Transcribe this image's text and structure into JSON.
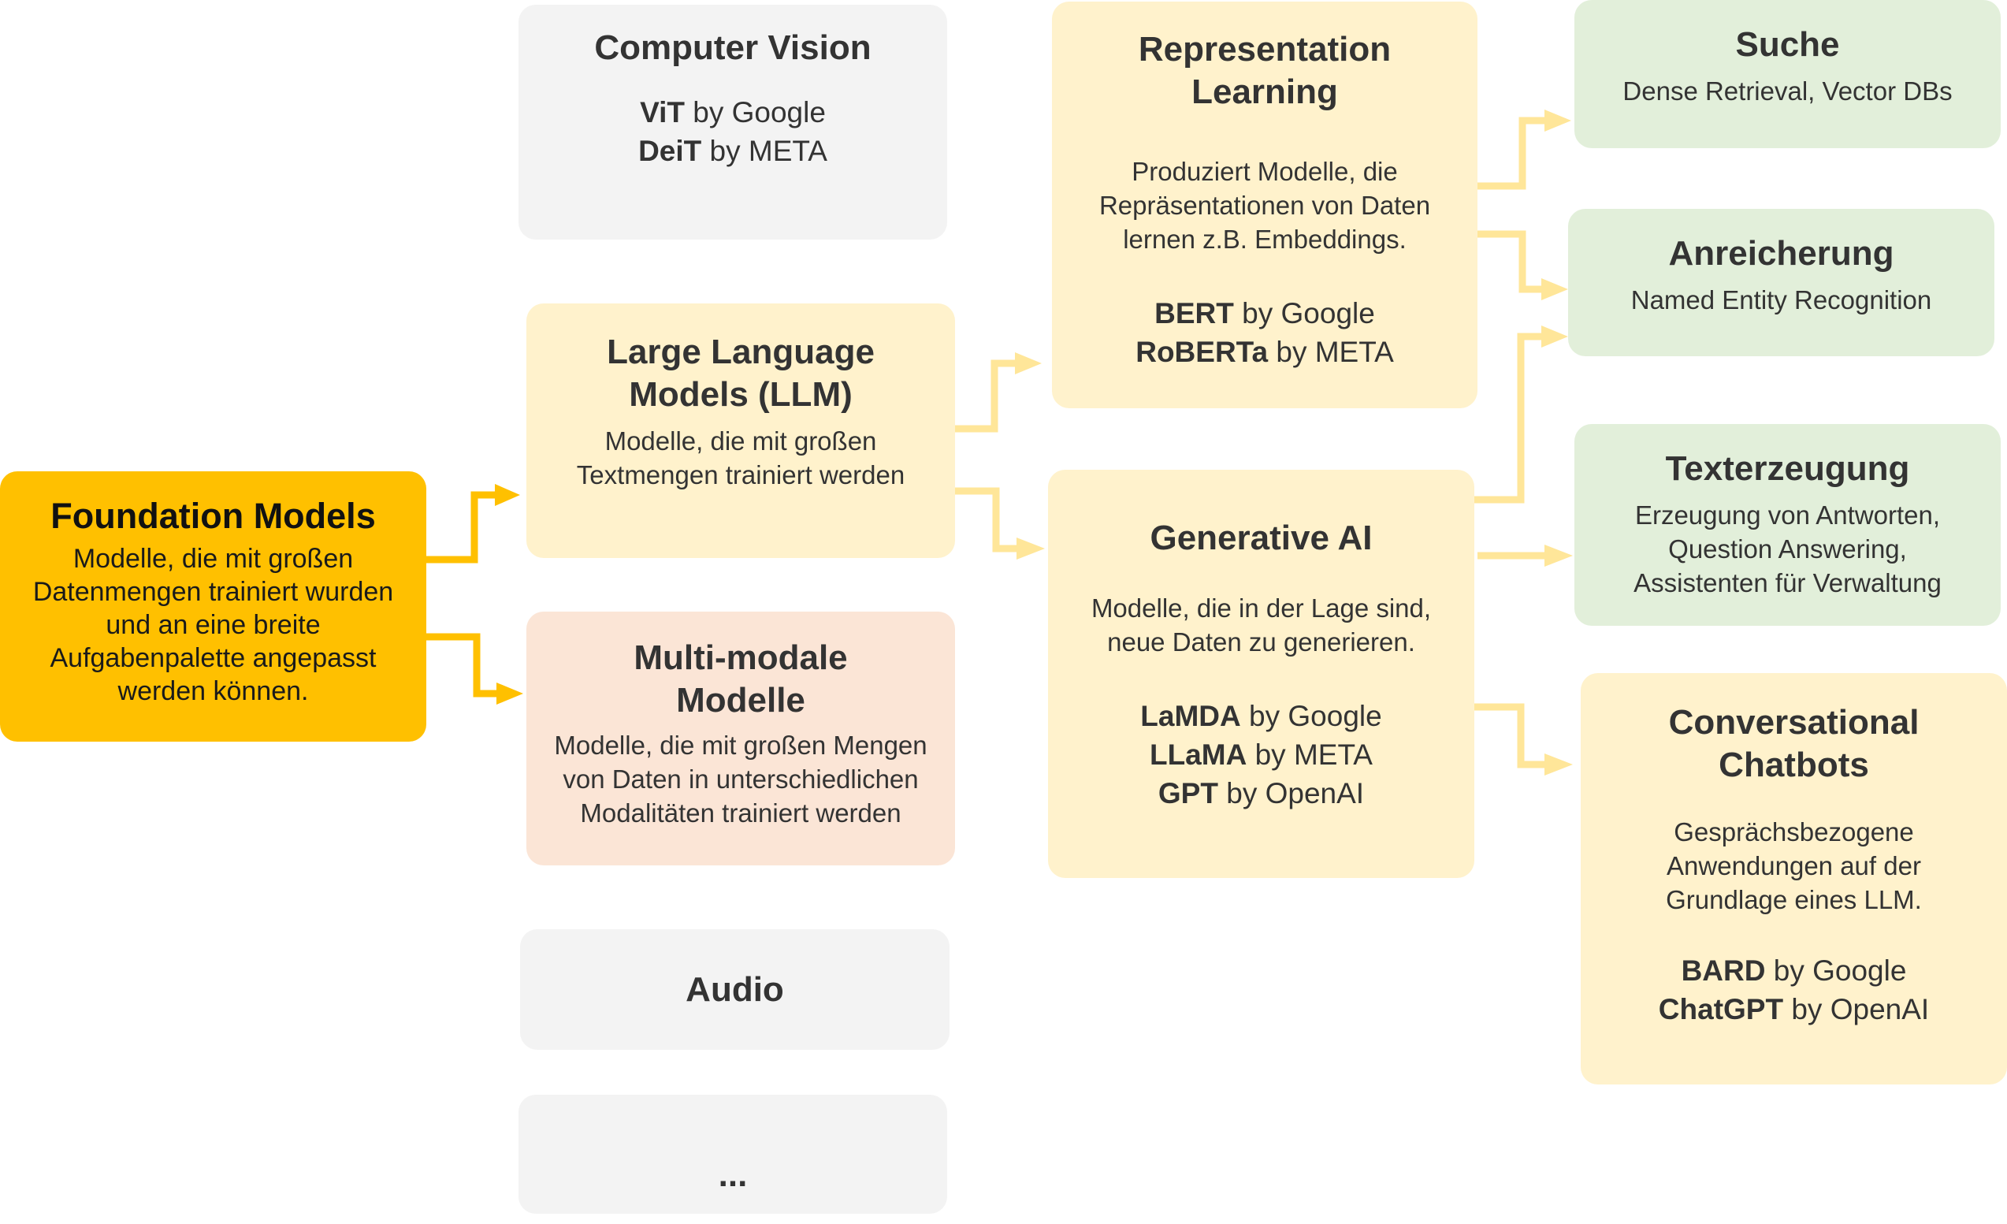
{
  "diagram": {
    "foundation": {
      "title": "Foundation Models",
      "description": [
        "Modelle, die mit großen",
        "Datenmengen trainiert wurden",
        "und an eine breite",
        "Aufgabenpalette angepasst",
        "werden können."
      ]
    },
    "computer_vision": {
      "title": "Computer Vision",
      "models": [
        {
          "name": "ViT",
          "by": "by Google"
        },
        {
          "name": "DeiT",
          "by": "by META"
        }
      ]
    },
    "llm": {
      "title": [
        "Large Language",
        "Models (LLM)"
      ],
      "description": [
        "Modelle, die mit großen",
        "Textmengen trainiert werden"
      ]
    },
    "multimodal": {
      "title": [
        "Multi-modale",
        "Modelle"
      ],
      "description": [
        "Modelle, die mit großen Mengen",
        "von Daten in unterschiedlichen",
        "Modalitäten trainiert werden"
      ]
    },
    "audio": {
      "title": "Audio"
    },
    "more": {
      "title": "..."
    },
    "representation_learning": {
      "title": [
        "Representation",
        "Learning"
      ],
      "description": [
        "Produziert Modelle, die",
        "Repräsentationen von Daten",
        "lernen z.B. Embeddings."
      ],
      "models": [
        {
          "name": "BERT",
          "by": "by Google"
        },
        {
          "name": "RoBERTa",
          "by": "by META"
        }
      ]
    },
    "generative_ai": {
      "title": "Generative AI",
      "description": [
        "Modelle, die in der Lage sind,",
        "neue Daten zu generieren."
      ],
      "models": [
        {
          "name": "LaMDA",
          "by": "by Google"
        },
        {
          "name": "LLaMA",
          "by": "by META"
        },
        {
          "name": "GPT",
          "by": "by OpenAI"
        }
      ]
    },
    "suche": {
      "title": "Suche",
      "description": [
        "Dense Retrieval, Vector DBs"
      ]
    },
    "anreicherung": {
      "title": "Anreicherung",
      "description": [
        "Named Entity Recognition"
      ]
    },
    "texterzeugung": {
      "title": "Texterzeugung",
      "description": [
        "Erzeugung von Antworten,",
        "Question Answering,",
        "Assistenten für Verwaltung"
      ]
    },
    "chatbots": {
      "title": [
        "Conversational",
        "Chatbots"
      ],
      "description": [
        "Gesprächsbezogene",
        "Anwendungen auf der",
        "Grundlage eines LLM."
      ],
      "models": [
        {
          "name": "BARD",
          "by": "by Google"
        },
        {
          "name": "ChatGPT",
          "by": "by OpenAI"
        }
      ]
    }
  },
  "colors": {
    "foundation": "#ffc000",
    "arrow_primary": "#ffc000",
    "arrow_secondary": "#ffe699",
    "gray_box": "#f3f3f3",
    "cream_box": "#fff2cc",
    "peach_box": "#fbe5d6",
    "green_box": "#e2efda"
  }
}
